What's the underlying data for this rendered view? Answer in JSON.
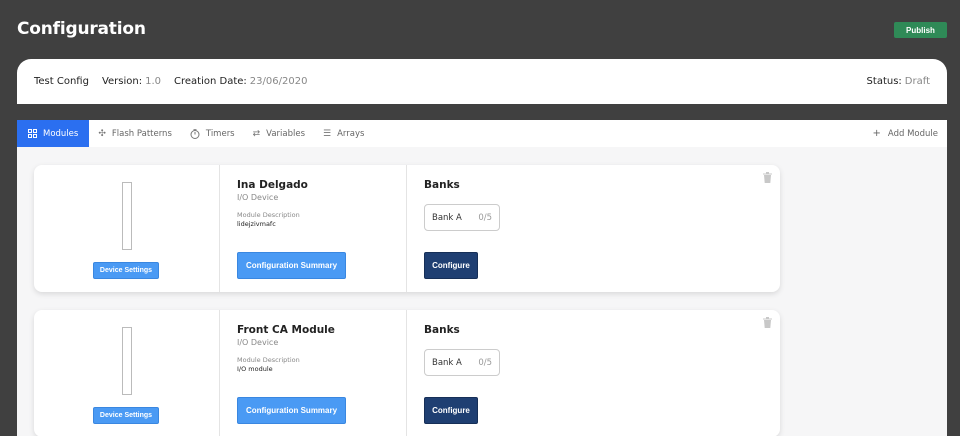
{
  "header": {
    "title": "Configuration",
    "publish_label": "Publish"
  },
  "info": {
    "name": "Test Config",
    "version_label": "Version:",
    "version": "1.0",
    "creation_label": "Creation Date:",
    "creation_date": "23/06/2020",
    "status_label": "Status:",
    "status": "Draft"
  },
  "tabs": [
    {
      "label": "Modules",
      "icon": "grid-icon",
      "active": true
    },
    {
      "label": "Flash Patterns",
      "icon": "sparkle-icon"
    },
    {
      "label": "Timers",
      "icon": "timer-icon"
    },
    {
      "label": "Variables",
      "icon": "variables-icon"
    },
    {
      "label": "Arrays",
      "icon": "list-icon"
    }
  ],
  "add_module_label": "Add Module",
  "modules": [
    {
      "name": "Ina Delgado",
      "type": "I/O Device",
      "description_label": "Module Description",
      "description": "lidejzivmafc",
      "device_settings_label": "Device Settings",
      "config_summary_label": "Configuration Summary",
      "banks_title": "Banks",
      "bank": {
        "name": "Bank A",
        "count": "0/5"
      },
      "configure_label": "Configure"
    },
    {
      "name": "Front CA Module",
      "type": "I/O Device",
      "description_label": "Module Description",
      "description": "I/O module",
      "device_settings_label": "Device Settings",
      "config_summary_label": "Configuration Summary",
      "banks_title": "Banks",
      "bank": {
        "name": "Bank A",
        "count": "0/5"
      },
      "configure_label": "Configure"
    }
  ],
  "colors": {
    "background": "#404040",
    "publish": "#2f8a57",
    "active_tab": "#2b6ff0",
    "primary_button": "#4a9af4",
    "configure_button": "#1f3f72"
  }
}
